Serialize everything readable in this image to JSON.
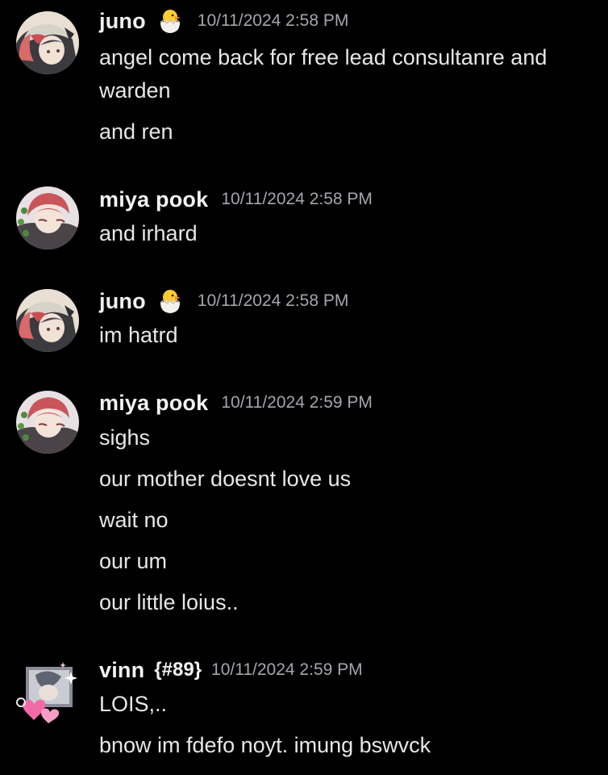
{
  "colors": {
    "background": "#000000",
    "username": "#f2f3f5",
    "timestamp": "#a4a6ad",
    "message_text": "#e6e7e9"
  },
  "messages": [
    {
      "author": "juno",
      "badge_icon": "hatching-chick-icon",
      "timestamp": "10/11/2024 2:58 PM",
      "lines": [
        "angel come back for free lead consultanre and",
        "warden",
        "and ren"
      ]
    },
    {
      "author": "miya pook",
      "timestamp": "10/11/2024 2:58 PM",
      "lines": [
        "and irhard"
      ]
    },
    {
      "author": "juno",
      "badge_icon": "hatching-chick-icon",
      "timestamp": "10/11/2024 2:58 PM",
      "lines": [
        "im hatrd"
      ]
    },
    {
      "author": "miya pook",
      "timestamp": "10/11/2024 2:59 PM",
      "lines": [
        "sighs",
        "our mother doesnt love us",
        "wait no",
        "our um",
        "our little loius.."
      ]
    },
    {
      "author": "vinn",
      "clan_tag": "{#89}",
      "timestamp": "10/11/2024 2:59 PM",
      "lines": [
        "LOIS,..",
        "bnow im fdefo noyt. imung bswvck"
      ]
    }
  ]
}
